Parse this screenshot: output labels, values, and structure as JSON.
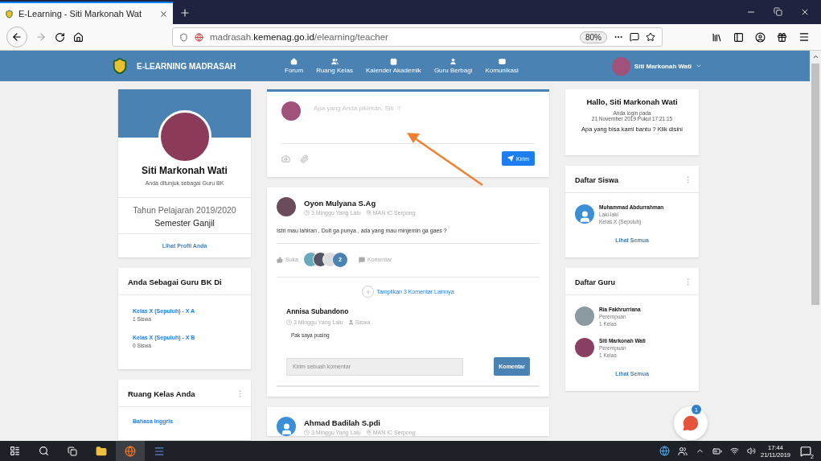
{
  "browser": {
    "tab_title": "E-Learning - Siti Markonah Wat",
    "url": "madrasah.**kemenag.go.id**/elearning/teacher",
    "zoom": "80%"
  },
  "navbar": {
    "brand": "E-LEARNING MADRASAH",
    "items": [
      {
        "label": "Forum"
      },
      {
        "label": "Ruang Kelas"
      },
      {
        "label": "Kalender Akademik"
      },
      {
        "label": "Guru Berbagi"
      },
      {
        "label": "Komunikasi"
      }
    ],
    "user": "Siti Markonah Wati"
  },
  "profile": {
    "name": "Siti Markonah Wati",
    "role": "Anda ditunjuk sebagai Guru BK",
    "year": "Tahun Pelajaran 2019/2020",
    "semester": "Semester Ganjil",
    "link": "Lihat Profil Anda"
  },
  "bk_classes": {
    "title": "Anda Sebagai Guru BK Di",
    "items": [
      {
        "name": "Kelas X (Sepuluh) - X A",
        "count": "1 Siswa"
      },
      {
        "name": "Kelas X (Sepuluh) - X B",
        "count": "0 Siswa"
      }
    ]
  },
  "classrooms": {
    "title": "Ruang Kelas Anda",
    "items": [
      {
        "name": "Bahasa Inggris"
      }
    ]
  },
  "composer": {
    "placeholder": "Apa yang Anda pikirkan, Siti  ?",
    "button": "Kirim"
  },
  "posts": [
    {
      "author": "Oyon Mulyana S.Ag",
      "kind": "photo",
      "time": "3 Minggu Yang Lalu",
      "location": "MAN IC Serpong",
      "body": "Istri mau lahiran , Duit ga punya , ada yang mau minjemin ga gaes ?",
      "like_label": "Suka",
      "like_count": "2",
      "comment_label": "Komentar",
      "more_comments": "Tampilkan 3 Komentar Lainnya",
      "comments": [
        {
          "author": "Annisa Subandono",
          "time": "3 Minggu Yang Lalu",
          "role": "Siswa",
          "body": "Pak saya pusing"
        }
      ],
      "comment_placeholder": "Kirim sebuah komentar",
      "comment_button": "Komentar"
    },
    {
      "author": "Ahmad Badilah S.pdi",
      "kind": "generic",
      "time": "3 Minggu Yang Lalu",
      "location": "MAN IC Serpong"
    }
  ],
  "greeting": {
    "title": "Hallo, Siti Markonah Wati",
    "login_label": "Anda login pada",
    "login_time": "21 November 2019 Pukul 17:21:15",
    "help": "Apa yang bisa kami bantu ? Klik disini"
  },
  "students": {
    "title": "Daftar Siswa",
    "items": [
      {
        "name": "Muhammad Abdurrahman",
        "kind": "generic",
        "line_1": "Laki-laki",
        "line_2": "Kelas X (Sepuluh)"
      }
    ],
    "link": "Lihat Semua"
  },
  "teachers": {
    "title": "Daftar Guru",
    "items": [
      {
        "name": "Ria Fakhrurriana",
        "kind": "photo",
        "line_1": "Perempuan",
        "line_2": "1 Kelas"
      },
      {
        "name": "Siti Markonah Wati",
        "kind": "photo",
        "line_1": "Perempuan",
        "line_2": "1 Kelas"
      }
    ],
    "link": "Lihat Semua"
  },
  "chat_badge": "1",
  "taskbar": {
    "time": "17:44",
    "date": "21/11/2019",
    "notifications": "2"
  }
}
